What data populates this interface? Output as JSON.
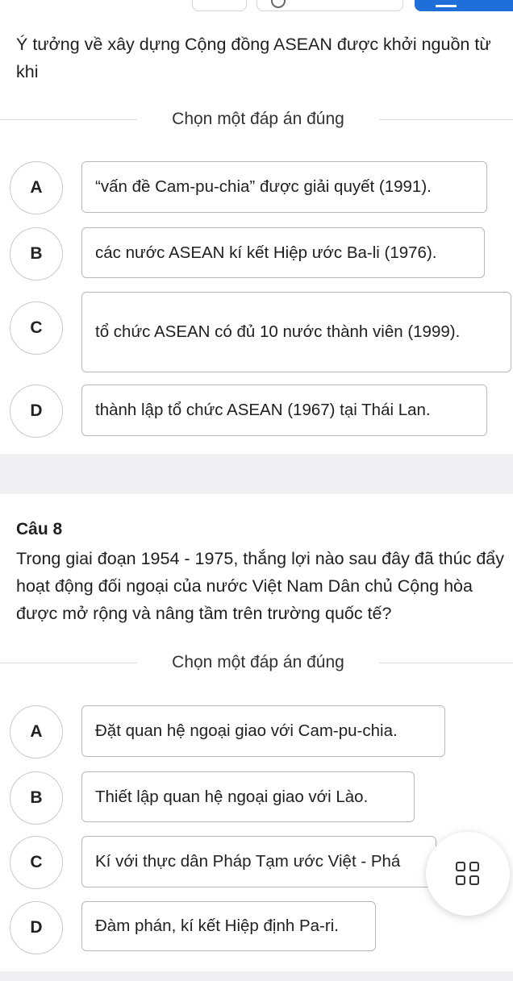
{
  "q7": {
    "question": "Ý tưởng về xây dựng Cộng đồng ASEAN được khởi nguồn từ khi",
    "choose_label": "Chọn một đáp án đúng",
    "options": [
      {
        "letter": "A",
        "text": "“vấn đề Cam-pu-chia” được giải quyết (1991)."
      },
      {
        "letter": "B",
        "text": "các nước ASEAN kí kết Hiệp ước Ba-li (1976)."
      },
      {
        "letter": "C",
        "text": "tổ chức ASEAN có đủ 10 nước thành viên (1999)."
      },
      {
        "letter": "D",
        "text": "thành lập tổ chức ASEAN (1967) tại Thái Lan."
      }
    ]
  },
  "q8": {
    "label": "Câu 8",
    "question": "Trong giai đoạn 1954 - 1975, thắng lợi nào sau đây đã thúc đẩy hoạt động đối ngoại của nước Việt Nam Dân chủ Cộng hòa được mở rộng và nâng tầm trên trường quốc tế?",
    "choose_label": "Chọn một đáp án đúng",
    "options": [
      {
        "letter": "A",
        "text": "Đặt quan hệ ngoại giao với Cam-pu-chia."
      },
      {
        "letter": "B",
        "text": "Thiết lập quan hệ ngoại giao với Lào."
      },
      {
        "letter": "C",
        "text": "Kí với thực dân Pháp Tạm ước Việt - Phá"
      },
      {
        "letter": "D",
        "text": "Đàm phán, kí kết Hiệp định Pa-ri."
      }
    ]
  },
  "fab": {
    "icon": "grid-icon"
  }
}
